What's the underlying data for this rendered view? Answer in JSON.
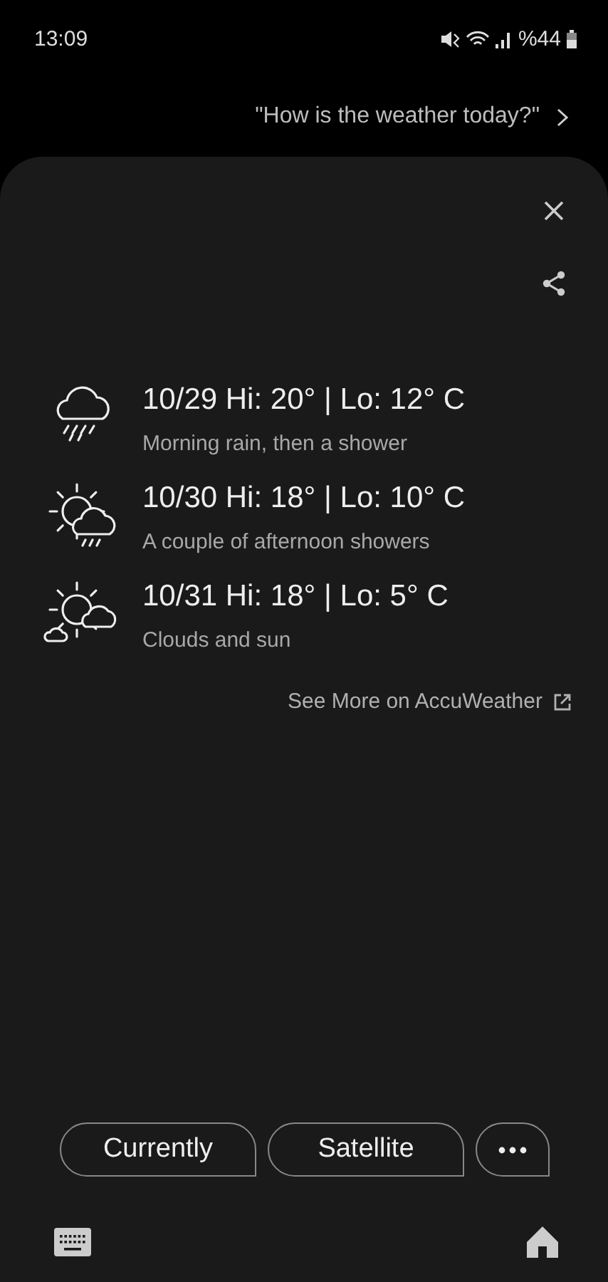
{
  "status_bar": {
    "time": "13:09",
    "battery": "%44"
  },
  "query": "\"How is the weather today?\"",
  "forecast": [
    {
      "kind": "rain",
      "title": "10/29 Hi: 20° | Lo: 12° C",
      "description": "Morning rain, then a shower"
    },
    {
      "kind": "showers",
      "title": "10/30 Hi: 18° | Lo: 10° C",
      "description": "A couple of afternoon showers"
    },
    {
      "kind": "partly",
      "title": "10/31 Hi: 18° | Lo: 5° C",
      "description": "Clouds and sun"
    }
  ],
  "link": "See More on AccuWeather",
  "chips": [
    {
      "kind": "text",
      "label": "Currently"
    },
    {
      "kind": "text",
      "label": "Satellite"
    },
    {
      "kind": "more"
    }
  ]
}
